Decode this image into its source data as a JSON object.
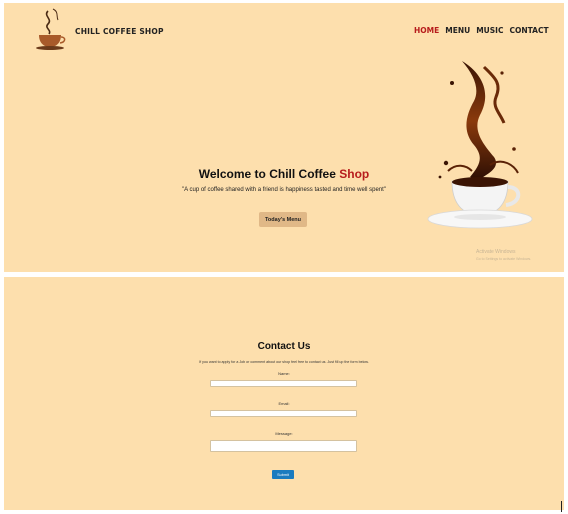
{
  "header": {
    "brand": "CHILL COFFEE SHOP",
    "nav": [
      "HOME",
      "MENU",
      "MUSIC",
      "CONTACT"
    ],
    "active_nav": "HOME"
  },
  "hero": {
    "title_main": "Welcome to Chill Coffee",
    "title_accent": "Shop",
    "quote": "\"A cup of coffee shared with a friend is happiness tasted and time well spent\"",
    "button_label": "Today's Menu"
  },
  "watermark": {
    "line1": "Activate Windows",
    "line2": "Go to Settings to activate Windows."
  },
  "contact": {
    "title": "Contact Us",
    "intro": "If you want to apply for a Job or comment about our shop feel free to contact us. Just fill up the form below.",
    "name_label": "Name:",
    "email_label": "Email:",
    "message_label": "Message:",
    "submit_label": "Submit"
  },
  "colors": {
    "background": "#fddfad",
    "accent": "#b71c1c",
    "button": "#e0b887",
    "submit": "#1a7bbf"
  },
  "icons": [
    "coffee-cup-logo-icon",
    "coffee-splash-cup-image"
  ]
}
